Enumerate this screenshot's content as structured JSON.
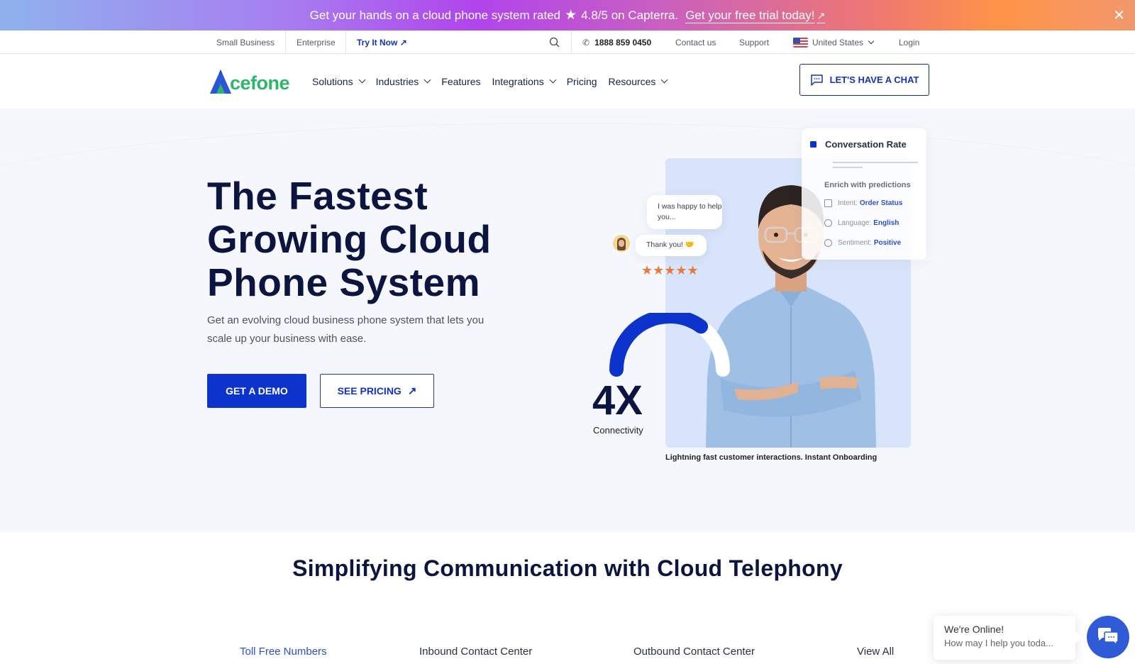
{
  "promo": {
    "text": "Get your hands on a cloud phone system rated",
    "rating": "4.8/5 on Capterra.",
    "cta": "Get your free trial today!",
    "cta_arrow": "↗",
    "close": "✕"
  },
  "utility": {
    "small_business": "Small Business",
    "enterprise": "Enterprise",
    "try_it_now": "Try It Now",
    "try_arrow": "↗",
    "phone": "1888 859 0450",
    "contact": "Contact us",
    "support": "Support",
    "country": "United States",
    "login": "Login"
  },
  "nav": {
    "brand": "cefone",
    "items": [
      {
        "label": "Solutions",
        "dropdown": true
      },
      {
        "label": "Industries",
        "dropdown": true
      },
      {
        "label": "Features",
        "dropdown": false
      },
      {
        "label": "Integrations",
        "dropdown": true
      },
      {
        "label": "Pricing",
        "dropdown": false
      },
      {
        "label": "Resources",
        "dropdown": true
      }
    ],
    "chat_button": "LET'S HAVE A CHAT"
  },
  "hero": {
    "title_lines": [
      "The Fastest",
      "Growing Cloud",
      "Phone System"
    ],
    "subtitle": "Get an evolving cloud business phone system that lets you scale up your business with ease.",
    "demo_button": "GET A DEMO",
    "pricing_button": "SEE PRICING",
    "pricing_arrow": "↗",
    "conversation_card": {
      "title": "Conversation Rate",
      "enrich": "Enrich with predictions",
      "rows": [
        {
          "key": "Intent:",
          "value": "Order Status",
          "icon": "grid-icon"
        },
        {
          "key": "Language:",
          "value": "English",
          "icon": "globe-icon"
        },
        {
          "key": "Sentiment:",
          "value": "Positive",
          "icon": "smiley-icon"
        }
      ]
    },
    "bubble_agent": "I was happy to help you...",
    "bubble_customer": "Thank you! 🤝",
    "rating_stars": 5,
    "stars_text": "★★★★★",
    "gauge_fraction": 0.7,
    "stat_value": "4X",
    "stat_label": "Connectivity",
    "caption": "Lightning fast customer interactions. Instant Onboarding"
  },
  "section": {
    "title": "Simplifying Communication with Cloud Telephony",
    "tabs": [
      {
        "label": "Toll Free Numbers",
        "active": true
      },
      {
        "label": "Inbound Contact Center",
        "active": false
      },
      {
        "label": "Outbound Contact Center",
        "active": false
      },
      {
        "label": "View All",
        "active": false
      }
    ]
  },
  "chat_widget": {
    "status": "We're Online!",
    "prompt": "How may I help you toda..."
  },
  "colors": {
    "brand_blue": "#0c33cc",
    "brand_green": "#2db56a",
    "navy": "#0b1540",
    "star_orange": "#e8793c"
  }
}
